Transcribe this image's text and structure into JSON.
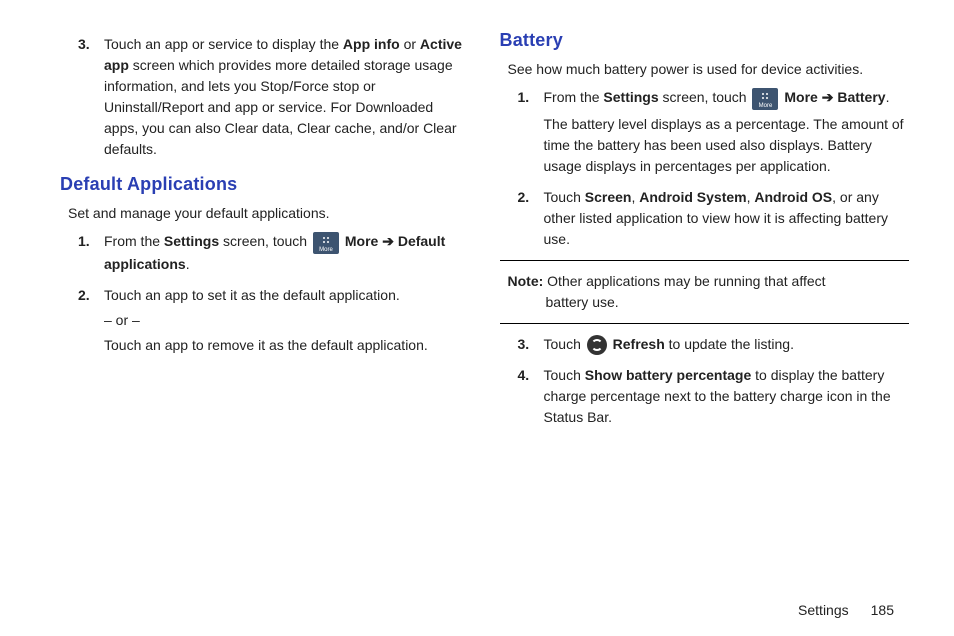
{
  "left": {
    "item3_num": "3.",
    "item3_a": "Touch an app or service to display the ",
    "item3_b1": "App info",
    "item3_mid": " or ",
    "item3_b2": "Active app",
    "item3_c": " screen which provides more detailed storage usage information, and lets you Stop/Force stop or Uninstall/Report and app or service. For Downloaded apps, you can also Clear data, Clear cache, and/or Clear defaults.",
    "heading": "Default Applications",
    "desc": "Set and manage your default applications.",
    "da1_num": "1.",
    "da1_a": "From the ",
    "da1_b1": "Settings",
    "da1_mid": " screen, touch ",
    "da1_more": "More",
    "da1_arrow": " ➔ ",
    "da1_b2": "Default applications",
    "da1_end": ".",
    "da2_num": "2.",
    "da2_a": "Touch an app to set it as the default application.",
    "da2_or": "– or –",
    "da2_b": "Touch an app to remove it as the default application."
  },
  "right": {
    "heading": "Battery",
    "desc": "See how much battery power is used for device activities.",
    "b1_num": "1.",
    "b1_a": "From the ",
    "b1_b1": "Settings",
    "b1_mid": " screen, touch ",
    "b1_more": "More",
    "b1_arrow": " ➔ ",
    "b1_b2": "Battery",
    "b1_end": ".",
    "b1_sub": "The battery level displays as a percentage. The amount of time the battery has been used also displays. Battery usage displays in percentages per application.",
    "b2_num": "2.",
    "b2_a": "Touch ",
    "b2_b1": "Screen",
    "b2_c1": ", ",
    "b2_b2": "Android System",
    "b2_c2": ", ",
    "b2_b3": "Android OS",
    "b2_rest": ", or any other listed application to view how it is affecting battery use.",
    "note_label": "Note:",
    "note_text1": " Other applications may be running that affect",
    "note_text2": "battery use.",
    "b3_num": "3.",
    "b3_a": "Touch ",
    "b3_refresh": "Refresh",
    "b3_b": " to update the listing.",
    "b4_num": "4.",
    "b4_a": "Touch ",
    "b4_b1": "Show battery percentage",
    "b4_rest": " to display the battery charge percentage next to the battery charge icon in the Status Bar."
  },
  "footer": {
    "section": "Settings",
    "page": "185"
  },
  "icons": {
    "more_label": "More"
  }
}
